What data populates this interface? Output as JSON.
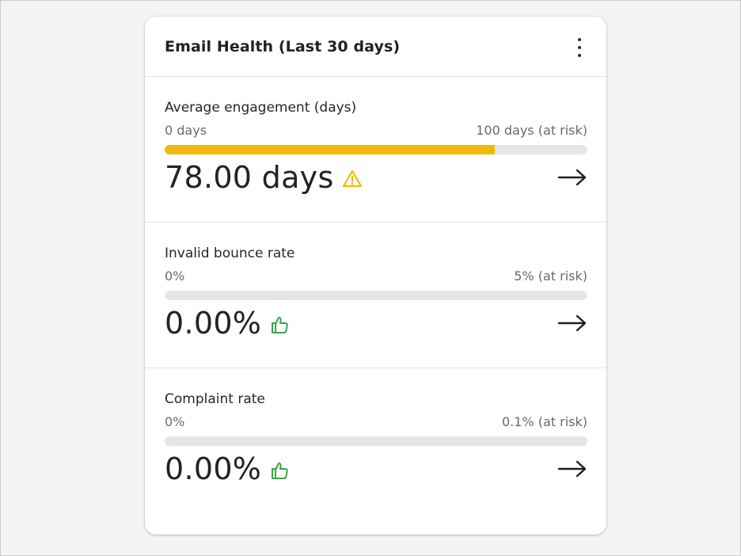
{
  "header": {
    "title": "Email Health (Last 30 days)"
  },
  "colors": {
    "warning": "#f0b90c",
    "good": "#3aa548",
    "track": "#e6e6e6"
  },
  "metrics": [
    {
      "label": "Average engagement (days)",
      "range_min": "0 days",
      "range_max": "100 days (at risk)",
      "value": "78.00 days",
      "progress_fraction": 0.78,
      "status": "warning",
      "status_icon": "warning-triangle-icon"
    },
    {
      "label": "Invalid bounce rate",
      "range_min": "0%",
      "range_max": "5% (at risk)",
      "value": "0.00%",
      "progress_fraction": 0,
      "status": "good",
      "status_icon": "thumbs-up-icon"
    },
    {
      "label": "Complaint rate",
      "range_min": "0%",
      "range_max": "0.1% (at risk)",
      "value": "0.00%",
      "progress_fraction": 0,
      "status": "good",
      "status_icon": "thumbs-up-icon"
    }
  ]
}
